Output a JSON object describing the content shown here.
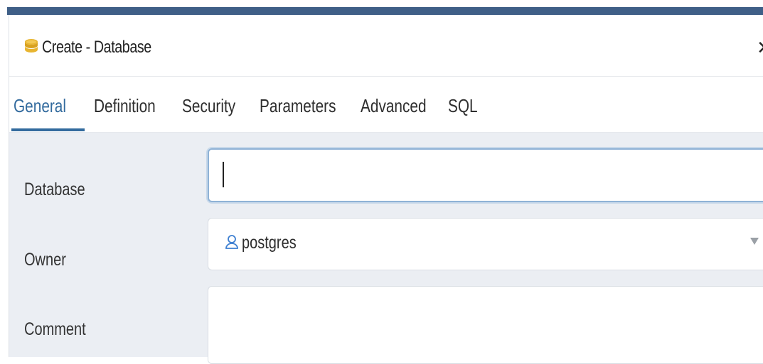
{
  "dialog": {
    "title": "Create - Database",
    "close_label": "✕",
    "title_icon": "database-icon"
  },
  "tabs": [
    {
      "label": "General",
      "active": true
    },
    {
      "label": "Definition",
      "active": false
    },
    {
      "label": "Security",
      "active": false
    },
    {
      "label": "Parameters",
      "active": false
    },
    {
      "label": "Advanced",
      "active": false
    },
    {
      "label": "SQL",
      "active": false
    }
  ],
  "form": {
    "database": {
      "label": "Database",
      "value": ""
    },
    "owner": {
      "label": "Owner",
      "value": "postgres",
      "icon": "user-icon"
    },
    "comment": {
      "label": "Comment",
      "value": ""
    }
  },
  "colors": {
    "accent": "#336b9e",
    "topbar": "#3f5f87",
    "form_bg": "#ebeef3",
    "db_icon": "#e8b530"
  }
}
